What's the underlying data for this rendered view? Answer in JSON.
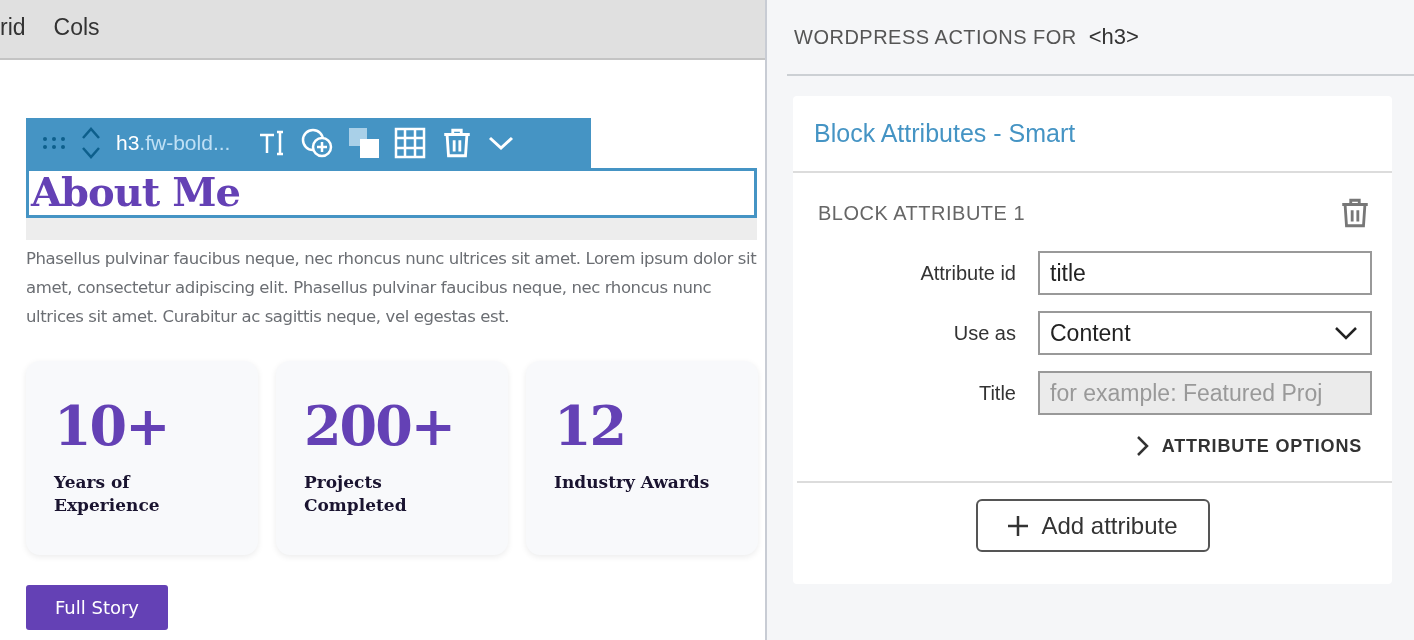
{
  "menu_bar": {
    "items": [
      {
        "label": "rid"
      },
      {
        "label": "Cols"
      }
    ]
  },
  "block_toolbar": {
    "tag": "h3",
    "classes": ".fw-bold..."
  },
  "canvas": {
    "heading": "About Me",
    "paragraph": "Phasellus pulvinar faucibus neque, nec rhoncus nunc ultrices sit amet. Lorem ipsum dolor sit amet, consectetur adipiscing elit. Phasellus pulvinar faucibus neque, nec rhoncus nunc ultrices sit amet. Curabitur ac sagittis neque, vel egestas est.",
    "stats": [
      {
        "value": "10+",
        "label": "Years of Experience"
      },
      {
        "value": "200+",
        "label": "Projects Completed"
      },
      {
        "value": "12",
        "label": "Industry Awards"
      }
    ],
    "button": "Full Story"
  },
  "panel": {
    "title": "WORDPRESS ACTIONS FOR",
    "element": "<h3>",
    "card_title": "Block Attributes - Smart",
    "section_title": "BLOCK ATTRIBUTE 1",
    "fields": [
      {
        "kind": "text",
        "label": "Attribute id",
        "value": "title",
        "disabled": false
      },
      {
        "kind": "select",
        "label": "Use as",
        "value": "Content",
        "disabled": false
      },
      {
        "kind": "text",
        "label": "Title",
        "placeholder": "for example: Featured Proj",
        "disabled": true
      }
    ],
    "options_toggle": {
      "label": "ATTRIBUTE OPTIONS",
      "expanded": false
    },
    "add_button": "Add attribute"
  }
}
